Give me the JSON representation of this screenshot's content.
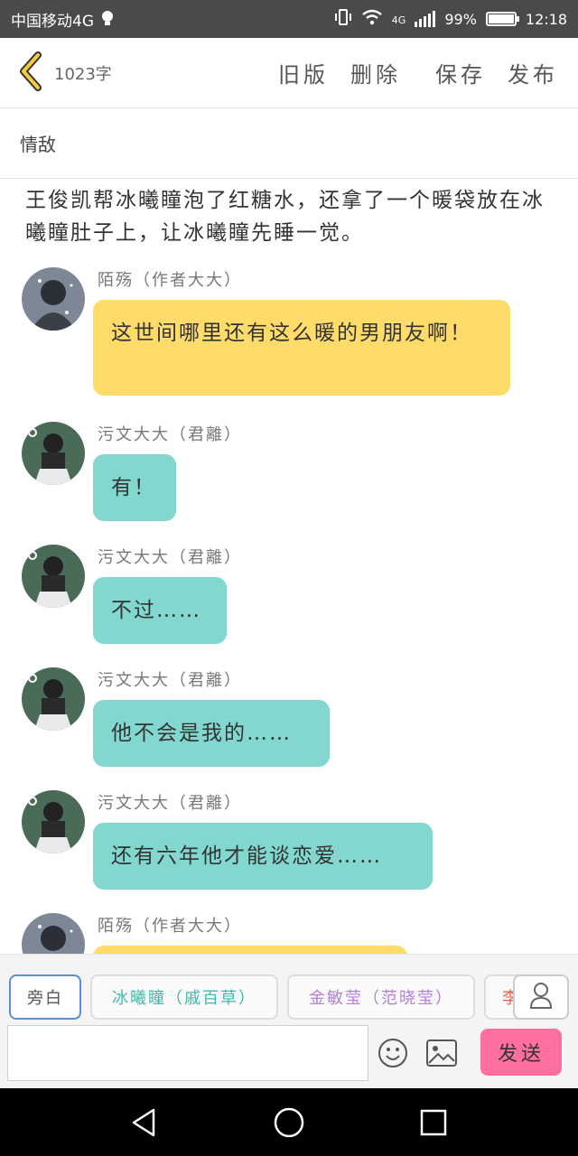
{
  "status": {
    "carrier": "中国移动4G",
    "net": "4G",
    "battery": "99%",
    "battery_fill": 0.99,
    "time": "12:18"
  },
  "header": {
    "word_count": "1023字",
    "actions": [
      "旧版",
      "删除",
      "保存",
      "发布"
    ]
  },
  "chapter_title": "情敌",
  "narration": "王俊凯帮冰曦瞳泡了红糖水，还拿了一个暖袋放在冰曦瞳肚子上，让冰曦瞳先睡一觉。",
  "messages": [
    {
      "sender": "陌殇（作者大大）",
      "text": "这世间哪里还有这么暖的男朋友啊！",
      "color": "yellow"
    },
    {
      "sender": "污文大大（君離）",
      "text": "有！",
      "color": "teal"
    },
    {
      "sender": "污文大大（君離）",
      "text": "不过……",
      "color": "teal"
    },
    {
      "sender": "污文大大（君離）",
      "text": "他不会是我的……",
      "color": "teal"
    },
    {
      "sender": "污文大大（君離）",
      "text": "还有六年他才能谈恋爱……",
      "color": "teal"
    },
    {
      "sender": "陌殇（作者大大）",
      "text": "",
      "color": "yellow"
    }
  ],
  "characters": [
    {
      "label": "旁白",
      "color": "#555555"
    },
    {
      "label": "冰曦瞳（戚百草）",
      "color": "#3fb9ad"
    },
    {
      "label": "金敏莹（范晓莹）",
      "color": "#b57fd6"
    },
    {
      "label": "李",
      "color": "#e8604a"
    }
  ],
  "composer": {
    "placeholder": "",
    "send_label": "发送"
  },
  "icons": {
    "back": "chevron-left-icon",
    "user": "user-icon",
    "emoji": "emoji-icon",
    "image": "image-icon",
    "nav": [
      "back-triangle-icon",
      "home-circle-icon",
      "recents-square-icon"
    ]
  }
}
